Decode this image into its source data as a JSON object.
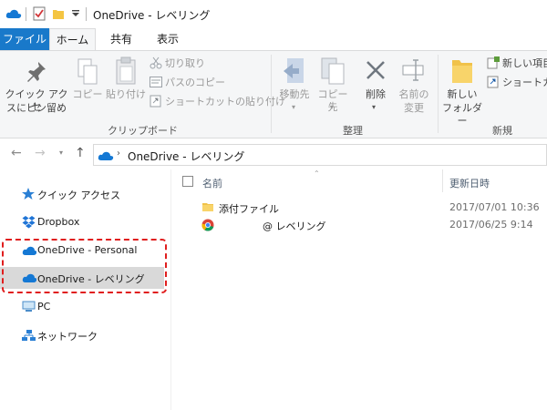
{
  "window": {
    "title": "OneDrive - レベリング"
  },
  "ribbon_tabs": [
    {
      "label": "ファイル"
    },
    {
      "label": "ホーム"
    },
    {
      "label": "共有"
    },
    {
      "label": "表示"
    }
  ],
  "ribbon": {
    "pin_quick_access": {
      "line1": "クイック アクセ",
      "line2": "スにピン留め"
    },
    "copy": "コピー",
    "paste": "貼り付け",
    "cut": "切り取り",
    "copy_path": "パスのコピー",
    "paste_shortcut": "ショートカットの貼り付け",
    "clipboard_group": "クリップボード",
    "move_to": "移動先",
    "copy_to": "コピー先",
    "delete": "削除",
    "rename": {
      "line1": "名前の",
      "line2": "変更"
    },
    "organize_group": "整理",
    "new_folder": {
      "line1": "新しい",
      "line2": "フォルダー"
    },
    "new_item": "新しい項目",
    "shortcut": "ショートカ",
    "new_group": "新規"
  },
  "address": {
    "path": "OneDrive - レベリング"
  },
  "nav_pane": {
    "items": [
      {
        "label": "クイック アクセス"
      },
      {
        "label": "Dropbox"
      },
      {
        "label": "OneDrive - Personal"
      },
      {
        "label": "OneDrive - レベリング"
      },
      {
        "label": "PC"
      },
      {
        "label": "ネットワーク"
      }
    ]
  },
  "file_list": {
    "columns": {
      "name": "名前",
      "modified": "更新日時"
    },
    "rows": [
      {
        "name": "添付ファイル",
        "date": "2017/07/01 10:36",
        "icon": "folder-icon"
      },
      {
        "name": "@ レベリング",
        "date": "2017/06/25 9:14",
        "icon": "chrome-icon"
      }
    ]
  },
  "colors": {
    "accent": "#1979ca",
    "highlight": "#e01e1e",
    "selected": "#d9d9d9"
  }
}
